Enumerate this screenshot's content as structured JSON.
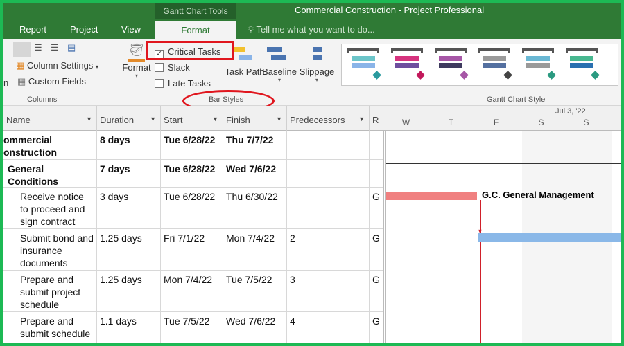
{
  "window": {
    "title": "Commercial Construction - Project Professional",
    "context_tab_group": "Gantt Chart Tools"
  },
  "tabs": [
    {
      "label": "Report"
    },
    {
      "label": "Project"
    },
    {
      "label": "View"
    },
    {
      "label": "Format",
      "active": true
    }
  ],
  "tell_me": "Tell me what you want to do...",
  "ribbon": {
    "columns_group": {
      "label": "Columns",
      "column_settings": "Column Settings",
      "custom_fields": "Custom Fields",
      "partial_left": "n"
    },
    "bar_styles_group": {
      "label": "Bar Styles",
      "format": "Format",
      "critical_tasks": {
        "label": "Critical Tasks",
        "checked": true
      },
      "slack": {
        "label": "Slack",
        "checked": false
      },
      "late_tasks": {
        "label": "Late Tasks",
        "checked": false
      },
      "task_path": "Task Path",
      "baseline": "Baseline",
      "slippage": "Slippage"
    },
    "gantt_style_group": {
      "label": "Gantt Chart Style",
      "styles": [
        {
          "top": "#6cc5c9",
          "bottom": "#8ab4e8",
          "diamond": "#2a9a9e"
        },
        {
          "top": "#d6337e",
          "bottom": "#6e4e9e",
          "diamond": "#c2185b"
        },
        {
          "top": "#a656a6",
          "bottom": "#3e3a5e",
          "diamond": "#a656a6"
        },
        {
          "top": "#9a9a9a",
          "bottom": "#5470a0",
          "diamond": "#444444"
        },
        {
          "top": "#6ab8d4",
          "bottom": "#9a9a9a",
          "diamond": "#2a9a80"
        },
        {
          "top": "#48b890",
          "bottom": "#2a70b0",
          "diamond": "#2a9a80"
        }
      ]
    }
  },
  "annotation_colors": {
    "highlight": "#e0161e"
  },
  "table": {
    "headers": [
      "Name",
      "Duration",
      "Start",
      "Finish",
      "Predecessors",
      "R"
    ],
    "rows": [
      {
        "name": "Commercial Construction",
        "name_lines": [
          "ommercial",
          "onstruction"
        ],
        "duration": "8 days",
        "start": "Tue 6/28/22",
        "finish": "Thu 7/7/22",
        "pred": "",
        "r": "",
        "bold": true
      },
      {
        "name": "General Conditions",
        "duration": "7 days",
        "start": "Tue 6/28/22",
        "finish": "Wed 7/6/22",
        "pred": "",
        "r": "",
        "bold": true
      },
      {
        "name": "Receive notice to proceed and sign contract",
        "duration": "3 days",
        "start": "Tue 6/28/22",
        "finish": "Thu 6/30/22",
        "pred": "",
        "r": "G"
      },
      {
        "name": "Submit bond and insurance documents",
        "duration": "1.25 days",
        "start": "Fri 7/1/22",
        "finish": "Mon 7/4/22",
        "pred": "2",
        "r": "G"
      },
      {
        "name": "Prepare and submit project schedule",
        "duration": "1.25 days",
        "start": "Mon 7/4/22",
        "finish": "Tue 7/5/22",
        "pred": "3",
        "r": "G"
      },
      {
        "name": "Prepare and submit schedule of...",
        "duration": "1.1 days",
        "start": "Tue 7/5/22",
        "finish": "Wed 7/6/22",
        "pred": "4",
        "r": "G"
      }
    ]
  },
  "timescale": {
    "week_label": "Jul 3, '22",
    "days": [
      "W",
      "T",
      "F",
      "S",
      "S"
    ]
  },
  "gantt": {
    "bar_label": "G.C. General Management",
    "critical_color": "#f08080",
    "normal_color": "#8ab8e8"
  }
}
